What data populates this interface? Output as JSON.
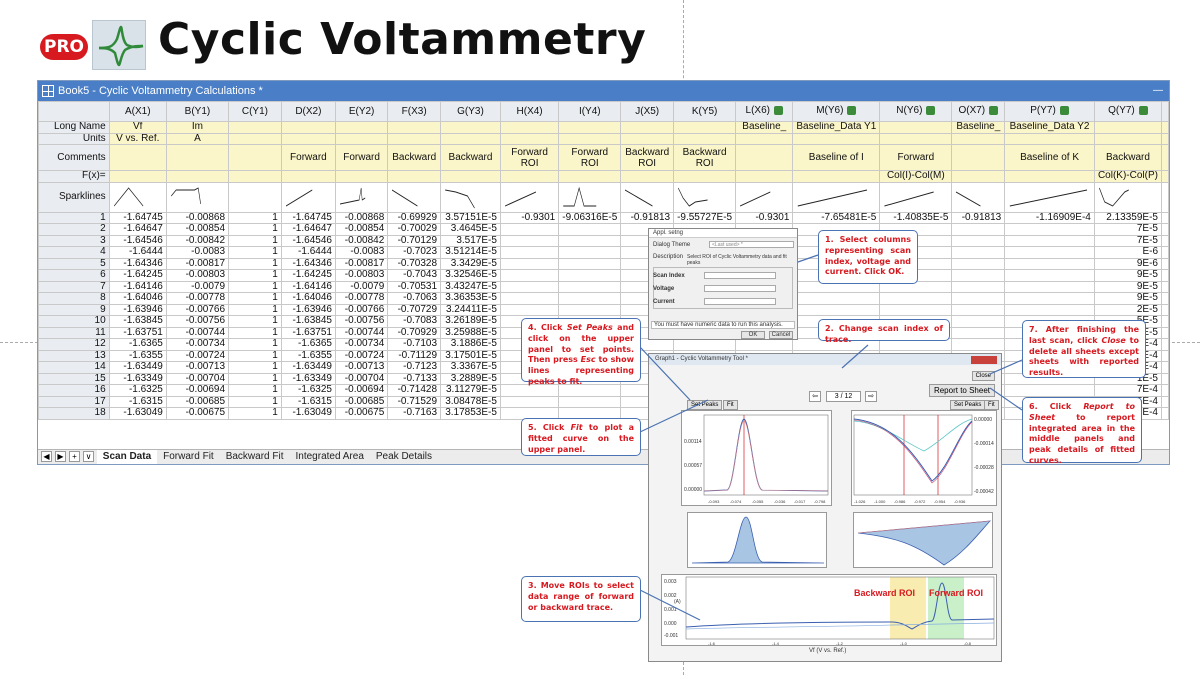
{
  "header": {
    "badge": "PRO",
    "title": "Cyclic Voltammetry"
  },
  "workbook": {
    "title": "Book5 - Cyclic Voltammetry Calculations *",
    "row_labels": {
      "long_name": "Long Name",
      "units": "Units",
      "comments": "Comments",
      "fx": "F(x)=",
      "sparklines": "Sparklines"
    },
    "columns": [
      {
        "head": "A(X1)",
        "long_name": "Vf",
        "units": "V vs. Ref.",
        "comments": "",
        "fx": "",
        "lock": false
      },
      {
        "head": "B(Y1)",
        "long_name": "Im",
        "units": "A",
        "comments": "",
        "fx": "",
        "lock": false
      },
      {
        "head": "C(Y1)",
        "long_name": "",
        "units": "",
        "comments": "",
        "fx": "",
        "lock": false
      },
      {
        "head": "D(X2)",
        "long_name": "",
        "units": "",
        "comments": "Forward",
        "fx": "",
        "lock": false
      },
      {
        "head": "E(Y2)",
        "long_name": "",
        "units": "",
        "comments": "Forward",
        "fx": "",
        "lock": false
      },
      {
        "head": "F(X3)",
        "long_name": "",
        "units": "",
        "comments": "Backward",
        "fx": "",
        "lock": false
      },
      {
        "head": "G(Y3)",
        "long_name": "",
        "units": "",
        "comments": "Backward",
        "fx": "",
        "lock": false
      },
      {
        "head": "H(X4)",
        "long_name": "",
        "units": "",
        "comments": "Forward ROI",
        "fx": "",
        "lock": false
      },
      {
        "head": "I(Y4)",
        "long_name": "",
        "units": "",
        "comments": "Forward ROI",
        "fx": "",
        "lock": false
      },
      {
        "head": "J(X5)",
        "long_name": "",
        "units": "",
        "comments": "Backward ROI",
        "fx": "",
        "lock": false
      },
      {
        "head": "K(Y5)",
        "long_name": "",
        "units": "",
        "comments": "Backward ROI",
        "fx": "",
        "lock": false
      },
      {
        "head": "L(X6)",
        "long_name": "Baseline_",
        "units": "",
        "comments": "",
        "fx": "",
        "lock": true
      },
      {
        "head": "M(Y6)",
        "long_name": "Baseline_Data Y1",
        "units": "",
        "comments": "Baseline of I",
        "fx": "",
        "lock": true
      },
      {
        "head": "N(Y6)",
        "long_name": "",
        "units": "",
        "comments": "Forward",
        "fx": "Col(I)-Col(M)",
        "lock": true
      },
      {
        "head": "O(X7)",
        "long_name": "Baseline_",
        "units": "",
        "comments": "",
        "fx": "",
        "lock": true
      },
      {
        "head": "P(Y7)",
        "long_name": "Baseline_Data Y2",
        "units": "",
        "comments": "Baseline of K",
        "fx": "",
        "lock": true
      },
      {
        "head": "Q(Y7)",
        "long_name": "",
        "units": "",
        "comments": "Backward",
        "fx": "Col(K)-Col(P)",
        "lock": true
      }
    ],
    "row1": [
      "-1.64745",
      "-0.00868",
      "1",
      "-1.64745",
      "-0.00868",
      "-0.69929",
      "3.57151E-5",
      "-0.9301",
      "-9.06316E-5",
      "-0.91813",
      "-9.55727E-5",
      "-0.9301",
      "-7.65481E-5",
      "-1.40835E-5",
      "-0.91813",
      "-1.16909E-4",
      "2.13359E-5"
    ],
    "rows": [
      {
        "n": "2",
        "a": "-1.64647",
        "b": "-0.00854",
        "c": "1",
        "d": "-1.64647",
        "e": "-0.00854",
        "f": "-0.70029",
        "g": "3.4645E-5",
        "q": "7E-5"
      },
      {
        "n": "3",
        "a": "-1.64546",
        "b": "-0.00842",
        "c": "1",
        "d": "-1.64546",
        "e": "-0.00842",
        "f": "-0.70129",
        "g": "3.517E-5",
        "q": "7E-5"
      },
      {
        "n": "4",
        "a": "-1.6444",
        "b": "-0.0083",
        "c": "1",
        "d": "-1.6444",
        "e": "-0.0083",
        "f": "-0.7023",
        "g": "3.51214E-5",
        "q": "E-6"
      },
      {
        "n": "5",
        "a": "-1.64346",
        "b": "-0.00817",
        "c": "1",
        "d": "-1.64346",
        "e": "-0.00817",
        "f": "-0.70328",
        "g": "3.3429E-5",
        "q": "9E-6"
      },
      {
        "n": "6",
        "a": "-1.64245",
        "b": "-0.00803",
        "c": "1",
        "d": "-1.64245",
        "e": "-0.00803",
        "f": "-0.7043",
        "g": "3.32546E-5",
        "q": "9E-5"
      },
      {
        "n": "7",
        "a": "-1.64146",
        "b": "-0.0079",
        "c": "1",
        "d": "-1.64146",
        "e": "-0.0079",
        "f": "-0.70531",
        "g": "3.43247E-5",
        "q": "9E-5"
      },
      {
        "n": "8",
        "a": "-1.64046",
        "b": "-0.00778",
        "c": "1",
        "d": "-1.64046",
        "e": "-0.00778",
        "f": "-0.7063",
        "g": "3.36353E-5",
        "q": "9E-5"
      },
      {
        "n": "9",
        "a": "-1.63946",
        "b": "-0.00766",
        "c": "1",
        "d": "-1.63946",
        "e": "-0.00766",
        "f": "-0.70729",
        "g": "3.24411E-5",
        "q": "2E-5"
      },
      {
        "n": "10",
        "a": "-1.63845",
        "b": "-0.00756",
        "c": "1",
        "d": "-1.63845",
        "e": "-0.00756",
        "f": "-0.7083",
        "g": "3.26189E-5",
        "q": "5E-5"
      },
      {
        "n": "11",
        "a": "-1.63751",
        "b": "-0.00744",
        "c": "1",
        "d": "-1.63751",
        "e": "-0.00744",
        "f": "-0.70929",
        "g": "3.25988E-5",
        "q": "7E-5"
      },
      {
        "n": "12",
        "a": "-1.6365",
        "b": "-0.00734",
        "c": "1",
        "d": "-1.6365",
        "e": "-0.00734",
        "f": "-0.7103",
        "g": "3.1886E-5",
        "q": "1E-4"
      },
      {
        "n": "13",
        "a": "-1.6355",
        "b": "-0.00724",
        "c": "1",
        "d": "-1.6355",
        "e": "-0.00724",
        "f": "-0.71129",
        "g": "3.17501E-5",
        "q": "4E-4"
      },
      {
        "n": "14",
        "a": "-1.63449",
        "b": "-0.00713",
        "c": "1",
        "d": "-1.63449",
        "e": "-0.00713",
        "f": "-0.7123",
        "g": "3.3367E-5",
        "q": "7E-4"
      },
      {
        "n": "15",
        "a": "-1.63349",
        "b": "-0.00704",
        "c": "1",
        "d": "-1.63349",
        "e": "-0.00704",
        "f": "-0.7133",
        "g": "3.2889E-5",
        "q": "1E-5"
      },
      {
        "n": "16",
        "a": "-1.6325",
        "b": "-0.00694",
        "c": "1",
        "d": "-1.6325",
        "e": "-0.00694",
        "f": "-0.71428",
        "g": "3.11279E-5",
        "q": "7E-4"
      },
      {
        "n": "17",
        "a": "-1.6315",
        "b": "-0.00685",
        "c": "1",
        "d": "-1.6315",
        "e": "-0.00685",
        "f": "-0.71529",
        "g": "3.08478E-5",
        "q": "5E-4"
      },
      {
        "n": "18",
        "a": "-1.63049",
        "b": "-0.00675",
        "c": "1",
        "d": "-1.63049",
        "e": "-0.00675",
        "f": "-0.7163",
        "g": "3.17853E-5",
        "q": "6E-4"
      }
    ],
    "tabs": [
      "Scan Data",
      "Forward Fit",
      "Backward Fit",
      "Integrated Area",
      "Peak Details"
    ]
  },
  "dialog": {
    "title": "Appl. setng",
    "theme_label": "Dialog Theme",
    "theme_value": "<Last used> *",
    "description_label": "Description",
    "description_text": "Select ROI of Cyclic Voltammetry data and fit peaks",
    "scan_index_label": "Scan Index",
    "voltage_label": "Voltage",
    "current_label": "Current",
    "message": "You must have numeric data to run this analysis.",
    "ok_label": "OK",
    "cancel_label": "Cancel"
  },
  "tool": {
    "title": "Graph1 - Cyclic Voltammetry Tool *",
    "close_label": "Close",
    "report_label": "Report to Sheet",
    "scan_display": "3 / 12",
    "set_peaks_label": "Set Peaks",
    "fit_label": "Fit",
    "bottom_ylabel": "(A)",
    "bottom_xlabel": "Vf (V vs. Ref.)",
    "backward_roi_label": "Backward ROI",
    "forward_roi_label": "Forward ROI",
    "upper_left_yticks": [
      "0.00114",
      "0.00057",
      "0.00000"
    ],
    "upper_left_xticks": [
      "-0.093",
      "-0.074",
      "-0.055",
      "-0.036",
      "-0.017",
      "-0.798"
    ],
    "upper_right_yticks": [
      "0.00000",
      "-0.00014",
      "-0.00028",
      "-0.00042"
    ],
    "upper_right_xticks": [
      "-1.026",
      "-1.000",
      "-0.986",
      "-0.972",
      "-0.954",
      "-0.936"
    ],
    "bottom_yticks": [
      "0.003",
      "0.002",
      "0.001",
      "0.000",
      "-0.001"
    ],
    "bottom_xticks": [
      "-1.6",
      "-1.4",
      "-1.2",
      "-1.0",
      "-0.8"
    ]
  },
  "callouts": {
    "c1": "1.  Select columns representing scan index, voltage and current. Click OK.",
    "c2": "2. Change scan index of trace.",
    "c3": "3. Move ROIs to select data range of forward or backward trace.",
    "c4_a": "4. Click ",
    "c4_em1": "Set Peaks",
    "c4_b": " and click on the upper panel to set points. Then press ",
    "c4_em2": "Esc",
    "c4_c": " to show lines representing peaks to fit.",
    "c5_a": "5. Click ",
    "c5_em": "Fit",
    "c5_b": " to plot a fitted curve on the upper panel.",
    "c6_a": "6. Click ",
    "c6_em": "Report to Sheet",
    "c6_b": " to report integrated area in the middle panels and peak details of fitted curves.",
    "c7_a": "7. After finishing the last scan, click ",
    "c7_em": "Close",
    "c7_b": " to delete all sheets except sheets with reported results."
  }
}
